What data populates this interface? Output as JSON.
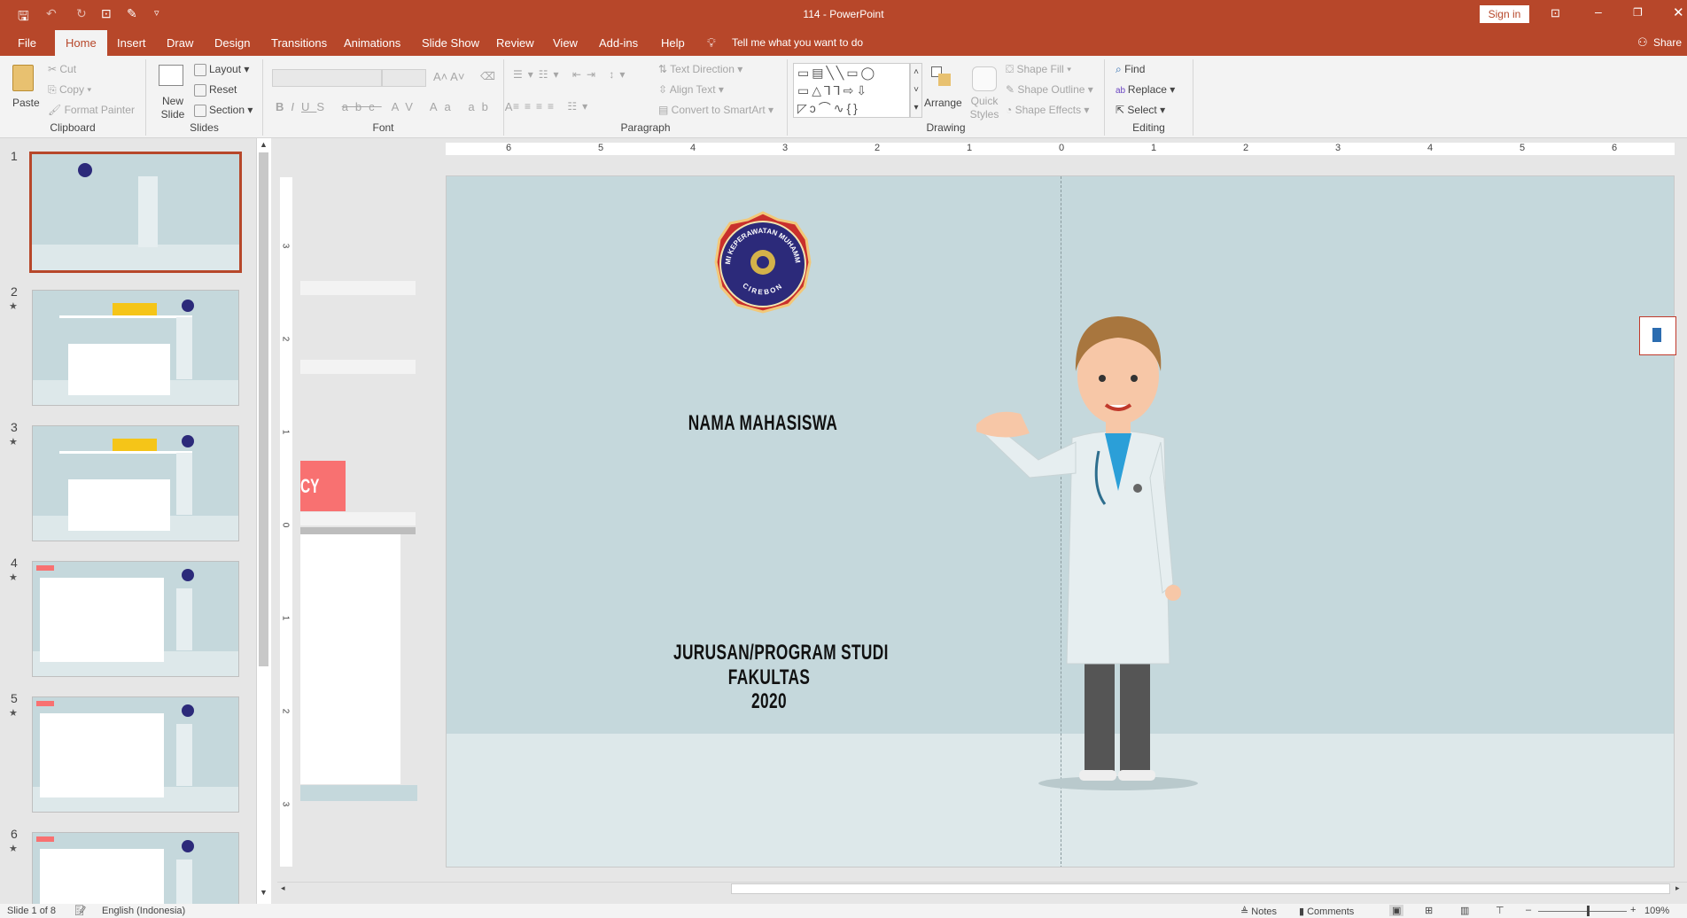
{
  "titlebar": {
    "title": "114  -  PowerPoint",
    "sign_in": "Sign in"
  },
  "tabs": [
    "File",
    "Home",
    "Insert",
    "Draw",
    "Design",
    "Transitions",
    "Animations",
    "Slide Show",
    "Review",
    "View",
    "Add-ins",
    "Help"
  ],
  "tell_me": "Tell me what you want to do",
  "share": "Share",
  "ribbon": {
    "clipboard": {
      "label": "Clipboard",
      "paste": "Paste",
      "cut": "Cut",
      "copy": "Copy",
      "format_painter": "Format Painter"
    },
    "slides": {
      "label": "Slides",
      "new_slide": "New Slide",
      "layout": "Layout",
      "reset": "Reset",
      "section": "Section"
    },
    "font": {
      "label": "Font",
      "font_name": "",
      "font_size": ""
    },
    "paragraph": {
      "label": "Paragraph",
      "text_direction": "Text Direction",
      "align_text": "Align Text",
      "convert_smartart": "Convert to SmartArt"
    },
    "drawing": {
      "label": "Drawing",
      "arrange": "Arrange",
      "quick_styles": "Quick Styles",
      "shape_fill": "Shape Fill",
      "shape_outline": "Shape Outline",
      "shape_effects": "Shape Effects"
    },
    "editing": {
      "label": "Editing",
      "find": "Find",
      "replace": "Replace",
      "select": "Select"
    }
  },
  "thumbnails": [
    {
      "num": "1",
      "star": ""
    },
    {
      "num": "2",
      "star": "★"
    },
    {
      "num": "3",
      "star": "★"
    },
    {
      "num": "4",
      "star": "★"
    },
    {
      "num": "5",
      "star": "★"
    },
    {
      "num": "6",
      "star": "★"
    }
  ],
  "ruler": {
    "h_ticks": [
      "6",
      "5",
      "4",
      "3",
      "2",
      "1",
      "0",
      "1",
      "2",
      "3",
      "4",
      "5",
      "6"
    ],
    "v_ticks": [
      "3",
      "2",
      "1",
      "0",
      "1",
      "2",
      "3"
    ]
  },
  "slide": {
    "logo_top": "AKADEMI KEPERAWATAN MUHAMMADIYAH",
    "logo_bottom": "CIREBON",
    "name": "NAMA MAHASISWA",
    "line1": "JURUSAN/PROGRAM STUDI",
    "line2": "FAKULTAS",
    "line3": "2020",
    "offslide_text": "CY",
    "colors": {
      "background": "#c5d8dc",
      "floor": "#dde8ea",
      "accent": "#f87171"
    }
  },
  "status": {
    "slide_info": "Slide 1 of 8",
    "language": "English (Indonesia)",
    "notes": "Notes",
    "comments": "Comments",
    "zoom": "109%",
    "zoom_level": 109
  }
}
